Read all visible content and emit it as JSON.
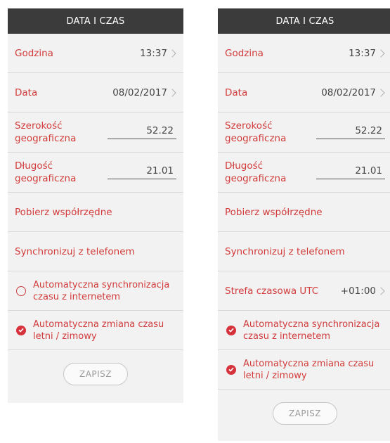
{
  "colors": {
    "header_bg": "#3b3b3b",
    "accent": "#d23b3b",
    "panel_bg": "#f2f2f2"
  },
  "screens": [
    {
      "header": "DATA I CZAS",
      "time": {
        "label": "Godzina",
        "value": "13:37"
      },
      "date": {
        "label": "Data",
        "value": "08/02/2017"
      },
      "latitude": {
        "label": "Szerokość geograficzna",
        "value": "52.22"
      },
      "longitude": {
        "label": "Długość geograficzna",
        "value": "21.01"
      },
      "fetch_coordinates": "Pobierz współrzędne",
      "sync_phone": "Synchronizuj z telefonem",
      "auto_sync": {
        "label": "Automatyczna synchronizacja czasu z internetem",
        "checked": false
      },
      "auto_dst": {
        "label": "Automatyczna zmiana czasu letni / zimowy",
        "checked": true
      },
      "save": "ZAPISZ"
    },
    {
      "header": "DATA I CZAS",
      "time": {
        "label": "Godzina",
        "value": "13:37"
      },
      "date": {
        "label": "Data",
        "value": "08/02/2017"
      },
      "latitude": {
        "label": "Szerokość geograficzna",
        "value": "52.22"
      },
      "longitude": {
        "label": "Długość geograficzna",
        "value": "21.01"
      },
      "fetch_coordinates": "Pobierz współrzędne",
      "sync_phone": "Synchronizuj z telefonem",
      "timezone": {
        "label": "Strefa czasowa UTC",
        "value": "+01:00"
      },
      "auto_sync": {
        "label": "Automatyczna synchronizacja czasu z internetem",
        "checked": true
      },
      "auto_dst": {
        "label": "Automatyczna zmiana czasu letni / zimowy",
        "checked": true
      },
      "save": "ZAPISZ"
    }
  ]
}
